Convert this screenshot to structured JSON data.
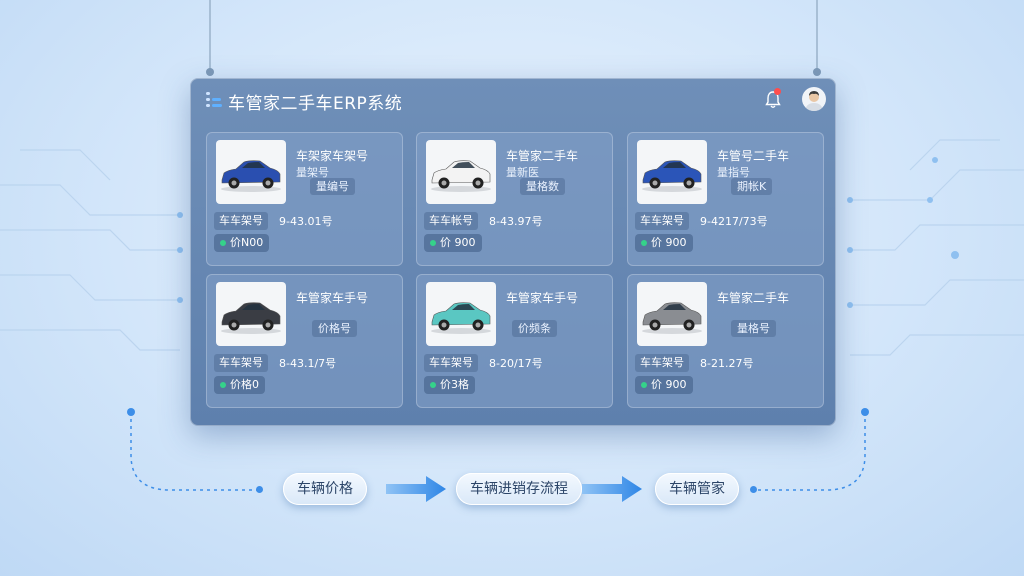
{
  "app": {
    "title": "车管家二手车ERP系统",
    "notification_count": "1"
  },
  "icons": {
    "logo": "list-logo-icon",
    "bell": "bell-icon",
    "avatar": "user-avatar-icon"
  },
  "colors": {
    "window": "#6a8ab4",
    "accent": "#3d8ee8",
    "price_dot": "#35d28a",
    "badge": "#ff4d4d"
  },
  "cars": [
    {
      "title": "车架家车架号",
      "sub": "量架号",
      "pill": "量编号",
      "key": "车车架号",
      "value": "9-43.01号",
      "price": "价N00",
      "color": "#2a4fb0"
    },
    {
      "title": "车管家二手车",
      "sub": "量新医",
      "pill": "量格数",
      "key": "车车帐号",
      "value": "8-43.97号",
      "price": "价 900",
      "color": "#f3f3f3"
    },
    {
      "title": "车管号二手车",
      "sub": "量指号",
      "pill": "期帐K",
      "key": "车车架号",
      "value": "9-4217/73号",
      "price": "价 900",
      "color": "#2b55b8"
    },
    {
      "title": "车管家车手号",
      "sub": "",
      "pill": "价格号",
      "key": "车车架号",
      "value": "8-43.1/7号",
      "price": "价格0",
      "color": "#3a3d44"
    },
    {
      "title": "车管家车手号",
      "sub": "",
      "pill": "价频条",
      "key": "车车架号",
      "value": "8-20/17号",
      "price": "价3格",
      "color": "#5ac7c2"
    },
    {
      "title": "车管家二手车",
      "sub": "",
      "pill": "量格号",
      "key": "车车架号",
      "value": "8-21.27号",
      "price": "价 900",
      "color": "#8a8d92"
    }
  ],
  "flow": [
    {
      "label": "车辆价格"
    },
    {
      "label": "车辆进销存流程"
    },
    {
      "label": "车辆管家"
    }
  ]
}
